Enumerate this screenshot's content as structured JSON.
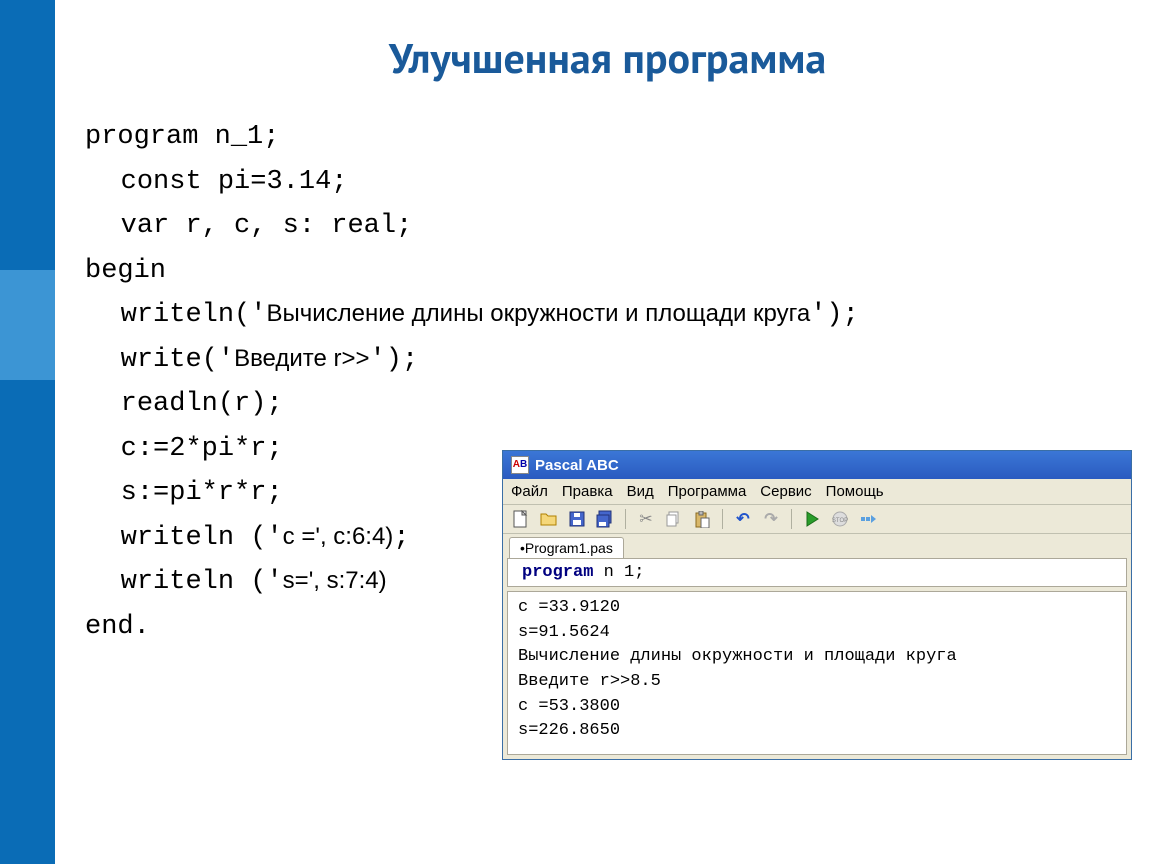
{
  "title": "Улучшенная программа",
  "code": {
    "l1a": "program",
    "l1b": " n_1;",
    "l2a": "const",
    "l2b": " pi=3.14;",
    "l3a": "var",
    "l3b": " r, c, s: real;",
    "l4": "begin",
    "l5a": "writeln('",
    "l5b": "Вычисление длины окружности и площади круга",
    "l5c": "');",
    "l6a": "write('",
    "l6b": "Введите r>>",
    "l6c": "');",
    "l7": "readln(r);",
    "l8": "c:=2*pi*r;",
    "l9": "s:=pi*r*r;",
    "l10a": "writeln ('",
    "l10b": "c =",
    "l10c": "', c:6:4)",
    "l10d": ";",
    "l11a": "writeln ('",
    "l11b": "s=",
    "l11c": "', s:7:4)",
    "l12": "end."
  },
  "window": {
    "title": "Pascal ABC",
    "menu": [
      "Файл",
      "Правка",
      "Вид",
      "Программа",
      "Сервис",
      "Помощь"
    ],
    "tab": "•Program1.pas",
    "editor_kw": "program",
    "editor_rest": " n 1;",
    "console": "c =33.9120\ns=91.5624\nВычисление длины окружности и площади круга\nВведите r>>8.5\nc =53.3800\ns=226.8650"
  }
}
